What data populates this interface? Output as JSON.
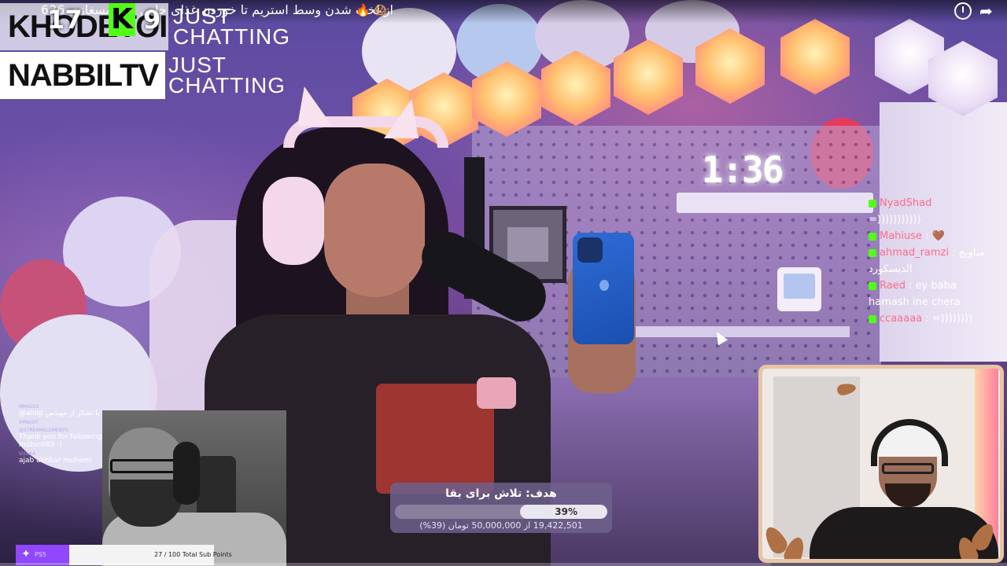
{
  "video": {
    "title": "از لخت شدن وسط استریم تا خوردن غذای خاص ... تریسغازی 636",
    "title_emoji": "🔥 😱",
    "clock_display": "1:36"
  },
  "channels": [
    {
      "name": "KHODETOI",
      "category": "JUST CHATTING",
      "viewers": "17",
      "kick_count": "9"
    },
    {
      "name": "NABBILTV",
      "category": "JUST CHATTING"
    }
  ],
  "kick_badge": "K",
  "video_chat": [
    {
      "user": "NyadShad",
      "text": ""
    },
    {
      "user": "",
      "text": "=)))))))))))"
    },
    {
      "user": "Mahiuse",
      "text": ": 🤎"
    },
    {
      "user": "ahmad_ramzi",
      "text": ": مناویچ"
    },
    {
      "user": "",
      "text": "الدیسکورد"
    },
    {
      "user": "Raed",
      "text": ": ey baba"
    },
    {
      "user": "",
      "text": "hamash ine chera"
    },
    {
      "user": "ccaaaaa",
      "text": ": =))))))))"
    }
  ],
  "goal": {
    "title": "هدف: تلاش برای بقا",
    "percent_label": "39%",
    "progress": 0.39,
    "amount": "19,422,501 از 50,000,000 تومان (39%)"
  },
  "reactor_chat": [
    {
      "user": "MM0353",
      "text": "@alidp با تشکر از مهندس",
      "big": false
    },
    {
      "user": "VIRAISIT",
      "text": "",
      "big": false
    },
    {
      "user": "",
      "text": "",
      "big": false
    },
    {
      "user": "@STREAMELEMENTS",
      "text": "Thank you for following mobin089 :)",
      "big": true
    },
    {
      "user": "VUXAA",
      "text": "ajab akhbar mohemi",
      "big": true
    }
  ],
  "sub_points": {
    "label": "PS5",
    "text": "27 / 100 Total Sub Points",
    "progress": 0.27
  },
  "icons": {
    "clock": "clock-icon",
    "share": "share-icon",
    "star": "star-icon"
  },
  "colors": {
    "kick_green": "#53fc18",
    "twitch_purple": "#9147ff"
  }
}
